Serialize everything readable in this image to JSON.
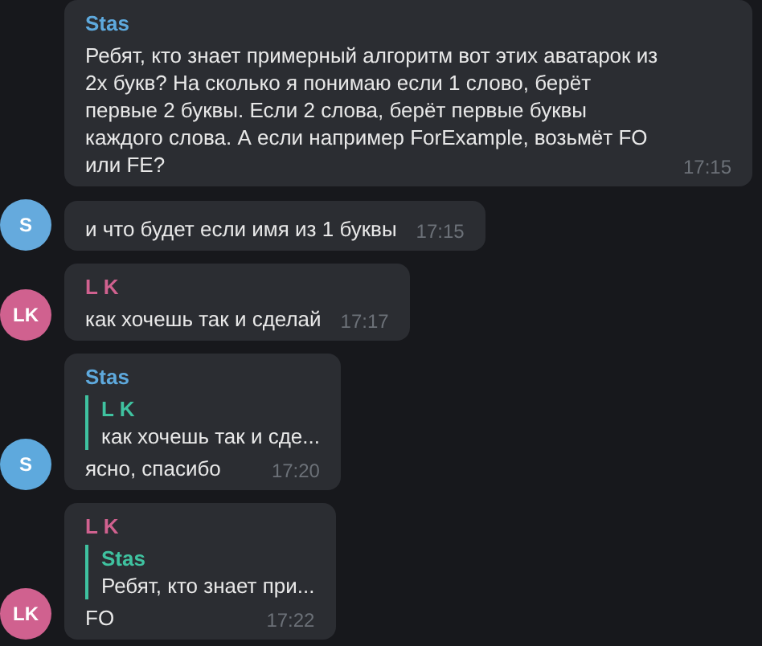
{
  "messages": [
    {
      "name": "Stas",
      "color": "#5ea9dd",
      "text": "Ребят, кто знает примерный алгоритм вот этих аватарок из 2х букв? На сколько я понимаю если 1 слово, берёт первые 2 буквы. Если 2 слова, берёт первые буквы каждого слова. А если например ForExample, возьмёт FO или FE?",
      "time": "17:15"
    },
    {
      "avatar": "S",
      "color": "#65aadd",
      "text": "и что будет если имя из 1 буквы",
      "time": "17:15"
    },
    {
      "name": "L K",
      "avatar": "LK",
      "color": "#d0618f",
      "text": "как хочешь так и сделай",
      "time": "17:17"
    },
    {
      "name": "Stas",
      "avatar": "S",
      "color": "#5ea9dd",
      "reply": {
        "name": "L K",
        "text": "как хочешь так и сде..."
      },
      "text": "ясно, спасибо",
      "time": "17:20"
    },
    {
      "name": "L K",
      "avatar": "LK",
      "color": "#d0618f",
      "reply": {
        "name": "Stas",
        "text": "Ребят, кто знает при..."
      },
      "text": "FO",
      "time": "17:22"
    }
  ]
}
